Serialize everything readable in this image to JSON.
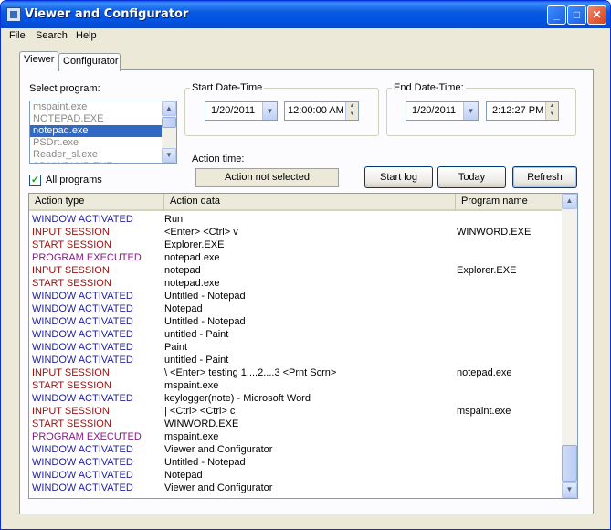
{
  "window": {
    "title": "Viewer and Configurator",
    "min": "_",
    "max": "□",
    "close": "✕"
  },
  "menu": [
    "File",
    "Search",
    "Help"
  ],
  "tabs": [
    "Viewer",
    "Configurator"
  ],
  "select_program": {
    "label": "Select program:",
    "items": [
      "mspaint.exe",
      "NOTEPAD.EXE",
      "notepad.exe",
      "PSDrt.exe",
      "Reader_sl.exe",
      "SDNWPLNB.EXE"
    ],
    "selected_index": 2
  },
  "all_programs": {
    "label": "All programs",
    "checked": true
  },
  "start": {
    "group": "Start Date-Time",
    "date": "1/20/2011",
    "time": "12:00:00 AM"
  },
  "end": {
    "group": "End Date-Time:",
    "date": "1/20/2011",
    "time": "2:12:27 PM"
  },
  "action_time": {
    "label": "Action time:",
    "value": "Action not selected"
  },
  "buttons": {
    "start_log": "Start log",
    "today": "Today",
    "refresh": "Refresh"
  },
  "table": {
    "columns": [
      "Action type",
      "Action data",
      "Program name"
    ],
    "rows": [
      {
        "type": "WINDOW ACTIVATED",
        "data": "Run",
        "program": ""
      },
      {
        "type": "INPUT SESSION",
        "data": " <Enter>  <Ctrl>  v",
        "program": "WINWORD.EXE"
      },
      {
        "type": "START SESSION",
        "data": "Explorer.EXE",
        "program": ""
      },
      {
        "type": "PROGRAM EXECUTED",
        "data": "notepad.exe",
        "program": ""
      },
      {
        "type": "INPUT SESSION",
        "data": "notepad",
        "program": "Explorer.EXE"
      },
      {
        "type": "START SESSION",
        "data": "notepad.exe",
        "program": ""
      },
      {
        "type": "WINDOW ACTIVATED",
        "data": "Untitled - Notepad",
        "program": ""
      },
      {
        "type": "WINDOW ACTIVATED",
        "data": "Notepad",
        "program": ""
      },
      {
        "type": "WINDOW ACTIVATED",
        "data": "Untitled - Notepad",
        "program": ""
      },
      {
        "type": "WINDOW ACTIVATED",
        "data": "untitled - Paint",
        "program": ""
      },
      {
        "type": "WINDOW ACTIVATED",
        "data": "Paint",
        "program": ""
      },
      {
        "type": "WINDOW ACTIVATED",
        "data": "untitled - Paint",
        "program": ""
      },
      {
        "type": "INPUT SESSION",
        "data": "\\ <Enter> testing 1....2....3 <Prnt Scrn>",
        "program": "notepad.exe"
      },
      {
        "type": "START SESSION",
        "data": "mspaint.exe",
        "program": ""
      },
      {
        "type": "WINDOW ACTIVATED",
        "data": "keylogger(note) - Microsoft Word",
        "program": ""
      },
      {
        "type": "INPUT SESSION",
        "data": "| <Ctrl>  <Ctrl>  c",
        "program": "mspaint.exe"
      },
      {
        "type": "START SESSION",
        "data": "WINWORD.EXE",
        "program": ""
      },
      {
        "type": "PROGRAM EXECUTED",
        "data": "mspaint.exe",
        "program": ""
      },
      {
        "type": "WINDOW ACTIVATED",
        "data": "Viewer and Configurator",
        "program": ""
      },
      {
        "type": "WINDOW ACTIVATED",
        "data": "Untitled - Notepad",
        "program": ""
      },
      {
        "type": "WINDOW ACTIVATED",
        "data": "Notepad",
        "program": ""
      },
      {
        "type": "WINDOW ACTIVATED",
        "data": "Viewer and Configurator",
        "program": ""
      }
    ]
  },
  "icons": {
    "combo": "▼",
    "up": "▲",
    "down": "▼",
    "check": "✓"
  }
}
